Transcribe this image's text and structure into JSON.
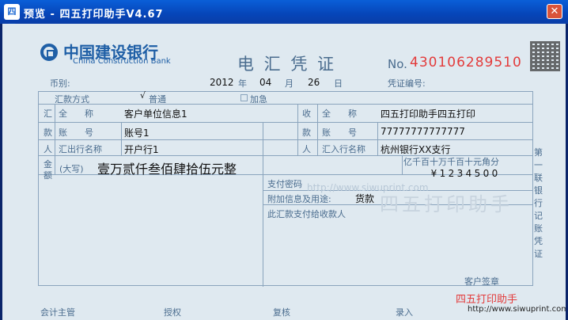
{
  "window": {
    "title": "预览 - 四五打印助手V4.67",
    "icon": "app-icon",
    "close_label": "✕"
  },
  "slip": {
    "bank_cn": "中国建设银行",
    "bank_en": "China Construction Bank",
    "doc_title": "电 汇 凭 证",
    "no_label": "No.",
    "no_value": "430106289510",
    "currency_label": "币别:",
    "year": "2012",
    "year_label": "年",
    "month": "04",
    "month_label": "月",
    "day": "26",
    "day_label": "日",
    "voucher_label": "凭证编号:",
    "remit_method_label": "汇款方式",
    "check_mark": "√",
    "normal_label": "普通",
    "urgent_label": "加急",
    "remitter_label": [
      "汇",
      "款",
      "人"
    ],
    "payee_label": [
      "收",
      "款",
      "人"
    ],
    "full_name_label": "全　　称",
    "account_label": "账　　号",
    "out_bank_label": "汇出行名称",
    "in_bank_label": "汇入行名称",
    "remitter_name": "客户单位信息1",
    "remitter_account": "账号1",
    "remitter_bank": "开户行1",
    "payee_name": "四五打印助手四五打印",
    "payee_account": "77777777777777",
    "payee_bank": "杭州银行XX支行",
    "amount_label": [
      "金",
      "额"
    ],
    "amount_upper_label": "(大写)",
    "amount_upper": "壹万贰仟叁佰肆拾伍元整",
    "digit_headers": [
      "亿",
      "千",
      "百",
      "十",
      "万",
      "千",
      "百",
      "十",
      "元",
      "角",
      "分"
    ],
    "digits": [
      "",
      "",
      "",
      "¥",
      "1",
      "2",
      "3",
      "4",
      "5",
      "0",
      "0"
    ],
    "pay_password_label": "支付密码",
    "extra_info_label": "附加信息及用途:",
    "extra_info_value": "货款",
    "notice_text": "此汇款支付给收款人",
    "side_label": "第一联 银行记账凭证",
    "customer_sign_label": "客户签章",
    "footer_labels": [
      "会计主管",
      "授权",
      "复核",
      "录入"
    ],
    "watermark_url": "http://www.siwuprint.com",
    "watermark_cn": "四五打印助手",
    "brand_text": "四五打印助手",
    "brand_url": "http://www.siwuprint.com"
  }
}
